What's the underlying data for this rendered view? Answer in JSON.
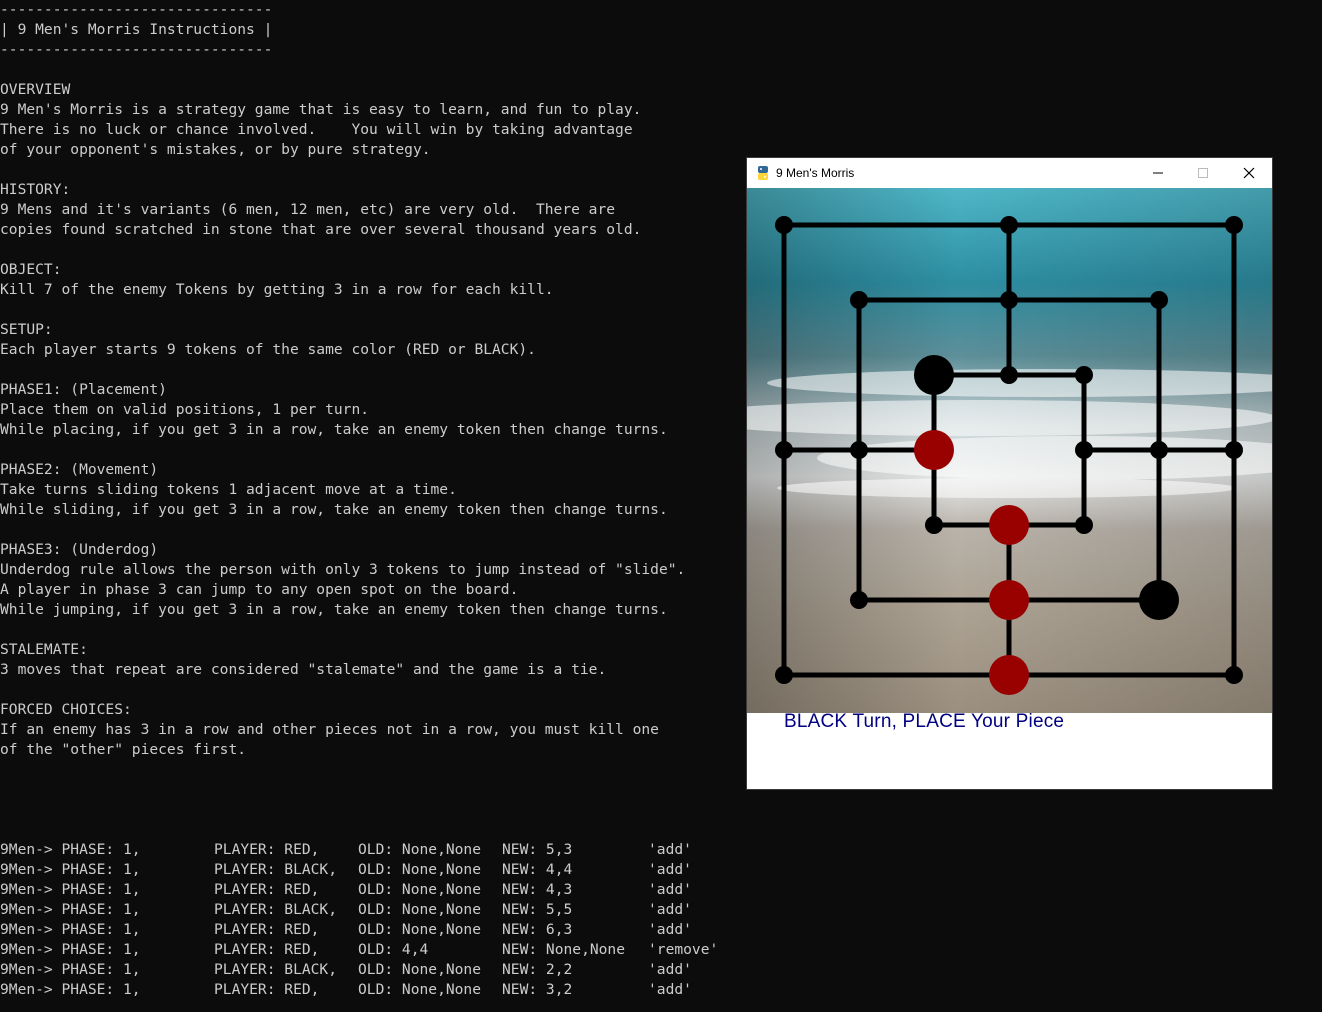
{
  "console": {
    "instructions": [
      "-------------------------------",
      "| 9 Men's Morris Instructions |",
      "-------------------------------",
      "",
      "OVERVIEW",
      "9 Men's Morris is a strategy game that is easy to learn, and fun to play.",
      "There is no luck or chance involved.    You will win by taking advantage",
      "of your opponent's mistakes, or by pure strategy.",
      "",
      "HISTORY:",
      "9 Mens and it's variants (6 men, 12 men, etc) are very old.  There are",
      "copies found scratched in stone that are over several thousand years old.",
      "",
      "OBJECT:",
      "Kill 7 of the enemy Tokens by getting 3 in a row for each kill.",
      "",
      "SETUP:",
      "Each player starts 9 tokens of the same color (RED or BLACK).",
      "",
      "PHASE1: (Placement)",
      "Place them on valid positions, 1 per turn.",
      "While placing, if you get 3 in a row, take an enemy token then change turns.",
      "",
      "PHASE2: (Movement)",
      "Take turns sliding tokens 1 adjacent move at a time.",
      "While sliding, if you get 3 in a row, take an enemy token then change turns.",
      "",
      "PHASE3: (Underdog)",
      "Underdog rule allows the person with only 3 tokens to jump instead of \"slide\".",
      "A player in phase 3 can jump to any open spot on the board.",
      "While jumping, if you get 3 in a row, take an enemy token then change turns.",
      "",
      "STALEMATE:",
      "3 moves that repeat are considered \"stalemate\" and the game is a tie.",
      "",
      "FORCED CHOICES:",
      "If an enemy has 3 in a row and other pieces not in a row, you must kill one",
      "of the \"other\" pieces first."
    ],
    "log": [
      {
        "phase": "9Men-> PHASE: 1,",
        "player": "PLAYER: RED,",
        "old": "OLD: None,None",
        "new": "NEW: 5,3",
        "action": "'add'"
      },
      {
        "phase": "9Men-> PHASE: 1,",
        "player": "PLAYER: BLACK,",
        "old": "OLD: None,None",
        "new": "NEW: 4,4",
        "action": "'add'"
      },
      {
        "phase": "9Men-> PHASE: 1,",
        "player": "PLAYER: RED,",
        "old": "OLD: None,None",
        "new": "NEW: 4,3",
        "action": "'add'"
      },
      {
        "phase": "9Men-> PHASE: 1,",
        "player": "PLAYER: BLACK,",
        "old": "OLD: None,None",
        "new": "NEW: 5,5",
        "action": "'add'"
      },
      {
        "phase": "9Men-> PHASE: 1,",
        "player": "PLAYER: RED,",
        "old": "OLD: None,None",
        "new": "NEW: 6,3",
        "action": "'add'"
      },
      {
        "phase": "9Men-> PHASE: 1,",
        "player": "PLAYER: RED,",
        "old": "OLD: 4,4",
        "new": "NEW: None,None",
        "action": "'remove'"
      },
      {
        "phase": "9Men-> PHASE: 1,",
        "player": "PLAYER: BLACK,",
        "old": "OLD: None,None",
        "new": "NEW: 2,2",
        "action": "'add'"
      },
      {
        "phase": "9Men-> PHASE: 1,",
        "player": "PLAYER: RED,",
        "old": "OLD: None,None",
        "new": "NEW: 3,2",
        "action": "'add'"
      }
    ]
  },
  "window": {
    "title": "9 Men's Morris",
    "minimize_icon": "minimize-icon",
    "maximize_icon": "maximize-icon",
    "close_icon": "close-icon",
    "status_text": "BLACK Turn, PLACE Your Piece",
    "status_color": "#000080"
  },
  "board": {
    "background": "beach-wave-photo",
    "pieces": [
      {
        "row": 2,
        "col": 2,
        "color": "black"
      },
      {
        "row": 3,
        "col": 2,
        "color": "red"
      },
      {
        "row": 4,
        "col": 3,
        "color": "red"
      },
      {
        "row": 5,
        "col": 3,
        "color": "red"
      },
      {
        "row": 5,
        "col": 5,
        "color": "black"
      },
      {
        "row": 6,
        "col": 3,
        "color": "red"
      }
    ],
    "colors": {
      "red": "#990000",
      "black": "#000000"
    }
  }
}
